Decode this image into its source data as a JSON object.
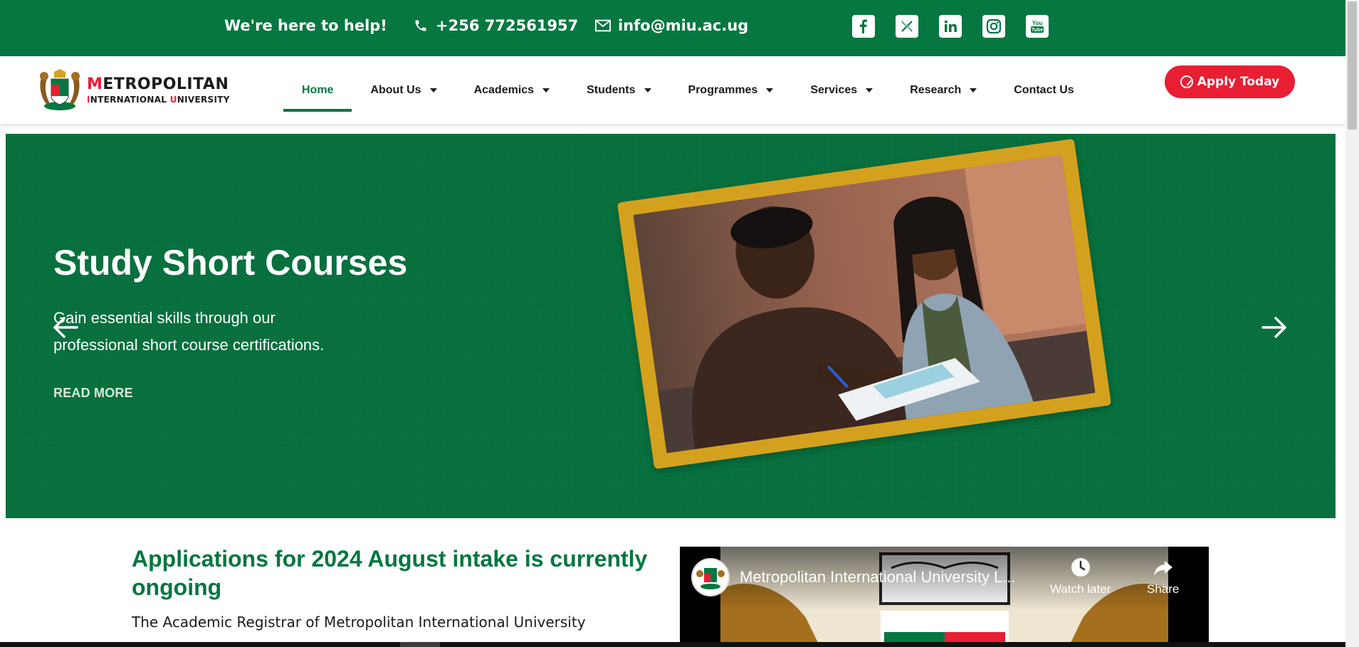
{
  "topbar": {
    "help_text": "We're here to help!",
    "phone": "+256 772561957",
    "email": "info@miu.ac.ug",
    "icons": [
      "phone-icon",
      "mail-icon"
    ],
    "social": [
      {
        "name": "facebook-icon",
        "glyph": "f"
      },
      {
        "name": "x-twitter-icon",
        "glyph": "𝕏"
      },
      {
        "name": "linkedin-icon",
        "glyph": "in"
      },
      {
        "name": "instagram-icon",
        "glyph": "◎"
      },
      {
        "name": "youtube-icon",
        "glyph": "You"
      }
    ],
    "bg_color": "#067740"
  },
  "header": {
    "logo_main_first": "M",
    "logo_main_rest": "ETROPOLITAN",
    "logo_sub_i": "I",
    "logo_sub_mid": "NTERNATIONAL ",
    "logo_sub_u": "U",
    "logo_sub_rest": "NIVERSITY",
    "nav": [
      {
        "label": "Home",
        "active": true,
        "dropdown": false
      },
      {
        "label": "About Us",
        "active": false,
        "dropdown": true
      },
      {
        "label": "Academics",
        "active": false,
        "dropdown": true
      },
      {
        "label": "Students",
        "active": false,
        "dropdown": true
      },
      {
        "label": "Programmes",
        "active": false,
        "dropdown": true
      },
      {
        "label": "Services",
        "active": false,
        "dropdown": true
      },
      {
        "label": "Research",
        "active": false,
        "dropdown": true
      },
      {
        "label": "Contact Us",
        "active": false,
        "dropdown": false
      }
    ],
    "apply_label": "Apply Today",
    "accent_red": "#e81e33"
  },
  "hero": {
    "title": "Study Short Courses",
    "description": "Gain essential skills through our professional short course certifications.",
    "read_more": "READ MORE",
    "prev_icon": "arrow-left-icon",
    "next_icon": "arrow-right-icon",
    "frame_color": "#d4a11e"
  },
  "announcement": {
    "title": "Applications for 2024 August intake is currently ongoing",
    "text": "The Academic Registrar of Metropolitan International University"
  },
  "video": {
    "title": "Metropolitan International University L...",
    "watch_later": "Watch later",
    "share": "Share"
  }
}
